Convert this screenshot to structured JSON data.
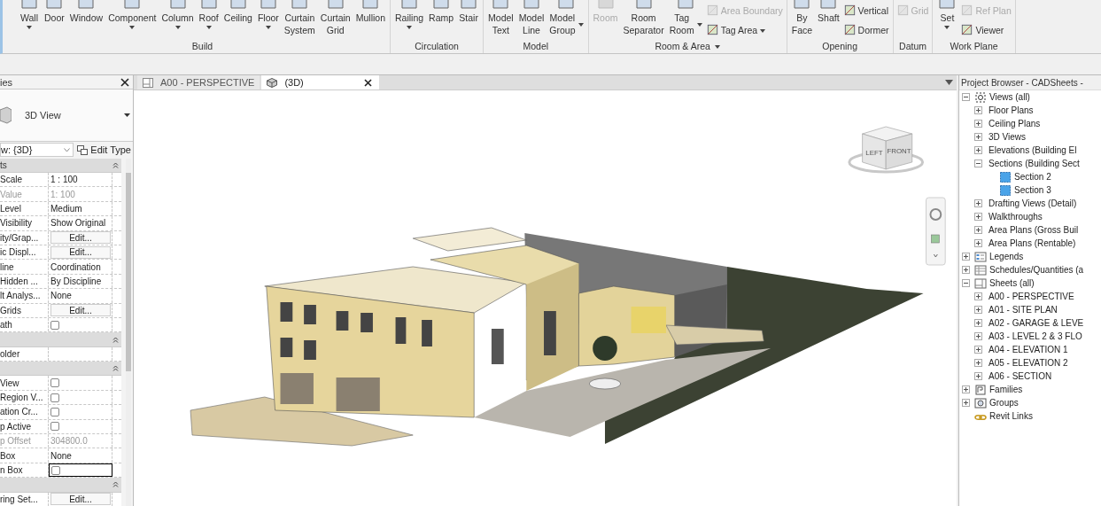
{
  "ribbon": {
    "groups": [
      {
        "label": "Build",
        "menu": false,
        "items": [
          {
            "kind": "large",
            "lines": [
              "Wall"
            ],
            "caret": true,
            "disabled": false
          },
          {
            "kind": "large",
            "lines": [
              "Door"
            ],
            "caret": false,
            "disabled": false
          },
          {
            "kind": "large",
            "lines": [
              "Window"
            ],
            "caret": false,
            "disabled": false
          },
          {
            "kind": "large",
            "lines": [
              "Component"
            ],
            "caret": true,
            "disabled": false
          },
          {
            "kind": "large",
            "lines": [
              "Column"
            ],
            "caret": true,
            "disabled": false
          },
          {
            "kind": "large",
            "lines": [
              "Roof"
            ],
            "caret": true,
            "disabled": false
          },
          {
            "kind": "large",
            "lines": [
              "Ceiling"
            ],
            "caret": false,
            "disabled": false
          },
          {
            "kind": "large",
            "lines": [
              "Floor"
            ],
            "caret": true,
            "disabled": false
          },
          {
            "kind": "large",
            "lines": [
              "Curtain",
              "System"
            ],
            "caret": false,
            "disabled": false
          },
          {
            "kind": "large",
            "lines": [
              "Curtain",
              "Grid"
            ],
            "caret": false,
            "disabled": false
          },
          {
            "kind": "large",
            "lines": [
              "Mullion"
            ],
            "caret": false,
            "disabled": false
          }
        ]
      },
      {
        "label": "Circulation",
        "menu": false,
        "items": [
          {
            "kind": "large",
            "lines": [
              "Railing"
            ],
            "caret": true,
            "disabled": false
          },
          {
            "kind": "large",
            "lines": [
              "Ramp"
            ],
            "caret": false,
            "disabled": false
          },
          {
            "kind": "large",
            "lines": [
              "Stair"
            ],
            "caret": false,
            "disabled": false
          }
        ]
      },
      {
        "label": "Model",
        "menu": false,
        "items": [
          {
            "kind": "large",
            "lines": [
              "Model",
              "Text"
            ],
            "caret": false,
            "disabled": false
          },
          {
            "kind": "large",
            "lines": [
              "Model",
              "Line"
            ],
            "caret": false,
            "disabled": false
          },
          {
            "kind": "large",
            "lines": [
              "Model",
              "Group"
            ],
            "caret": true,
            "disabled": false
          }
        ]
      },
      {
        "label": "Room & Area",
        "menu": true,
        "items": [
          {
            "kind": "large",
            "lines": [
              "Room"
            ],
            "caret": false,
            "disabled": true
          },
          {
            "kind": "large",
            "lines": [
              "Room",
              "Separator"
            ],
            "caret": false,
            "disabled": false
          },
          {
            "kind": "large",
            "lines": [
              "Tag",
              "Room"
            ],
            "caret": true,
            "disabled": false
          },
          {
            "kind": "stack",
            "items": [
              {
                "label": "Area  Boundary",
                "caret": false,
                "disabled": true
              },
              {
                "label": "Tag  Area",
                "caret": true,
                "disabled": false
              }
            ]
          }
        ]
      },
      {
        "label": "Opening",
        "menu": false,
        "items": [
          {
            "kind": "large",
            "lines": [
              "By",
              "Face"
            ],
            "caret": false,
            "disabled": false
          },
          {
            "kind": "large",
            "lines": [
              "Shaft"
            ],
            "caret": false,
            "disabled": false
          },
          {
            "kind": "stack",
            "items": [
              {
                "label": "Vertical",
                "caret": false,
                "disabled": false
              },
              {
                "label": "Dormer",
                "caret": false,
                "disabled": false
              }
            ]
          }
        ]
      },
      {
        "label": "Datum",
        "menu": false,
        "items": [
          {
            "kind": "stack",
            "items": [
              {
                "label": "Grid",
                "caret": false,
                "disabled": true
              }
            ]
          }
        ]
      },
      {
        "label": "Work Plane",
        "menu": false,
        "items": [
          {
            "kind": "large",
            "lines": [
              "Set"
            ],
            "caret": true,
            "disabled": false
          },
          {
            "kind": "stack",
            "items": [
              {
                "label": "Ref Plan",
                "caret": false,
                "disabled": true
              },
              {
                "label": "Viewer",
                "caret": false,
                "disabled": false
              }
            ]
          }
        ]
      }
    ]
  },
  "properties": {
    "title": "ies",
    "type_name": "3D View",
    "instance_selector": "w: {3D}",
    "edit_type": "Edit Type",
    "rows": [
      {
        "kind": "header",
        "label": "ts"
      },
      {
        "kind": "text",
        "label": "Scale",
        "value": "1 : 100",
        "disabled": false
      },
      {
        "kind": "text",
        "label": "Value",
        "value": "1: 100",
        "disabled": true
      },
      {
        "kind": "text",
        "label": "Level",
        "value": "Medium",
        "disabled": false
      },
      {
        "kind": "text",
        "label": "Visibility",
        "value": "Show Original",
        "disabled": false
      },
      {
        "kind": "button",
        "label": "ity/Grap...",
        "value": "Edit...",
        "disabled": false
      },
      {
        "kind": "button",
        "label": "ic Displ...",
        "value": "Edit...",
        "disabled": false
      },
      {
        "kind": "text",
        "label": "line",
        "value": "Coordination",
        "disabled": false
      },
      {
        "kind": "text",
        "label": "Hidden ...",
        "value": "By Discipline",
        "disabled": false
      },
      {
        "kind": "text",
        "label": "lt Analys...",
        "value": "None",
        "disabled": false
      },
      {
        "kind": "button",
        "label": "Grids",
        "value": "Edit...",
        "disabled": false
      },
      {
        "kind": "checkbox",
        "label": "ath",
        "checked": false,
        "disabled": false
      },
      {
        "kind": "header"
      },
      {
        "kind": "empty",
        "label": "older",
        "disabled": false
      },
      {
        "kind": "header"
      },
      {
        "kind": "checkbox",
        "label": "View",
        "checked": false,
        "disabled": false
      },
      {
        "kind": "checkbox",
        "label": "Region V...",
        "checked": false,
        "disabled": false
      },
      {
        "kind": "checkbox",
        "label": "ation Cr...",
        "checked": false,
        "disabled": false
      },
      {
        "kind": "checkbox",
        "label": "p Active",
        "checked": false,
        "disabled": false
      },
      {
        "kind": "text",
        "label": "p Offset",
        "value": "304800.0",
        "disabled": true
      },
      {
        "kind": "text",
        "label": "Box",
        "value": "None",
        "disabled": false
      },
      {
        "kind": "checkbox",
        "label": "n Box",
        "checked": false,
        "disabled": false,
        "focused": true
      },
      {
        "kind": "header"
      },
      {
        "kind": "button",
        "label": "ring Set...",
        "value": "Edit...",
        "disabled": false
      }
    ]
  },
  "view_tabs": [
    {
      "label": "A00 - PERSPECTIVE",
      "kind": "sheet",
      "selected": false
    },
    {
      "label": "(3D)",
      "kind": "model",
      "selected": true
    }
  ],
  "viewcube": {
    "faces": [
      "LEFT",
      "FRONT"
    ]
  },
  "browser": {
    "title": "Project Browser - CADSheets -",
    "tree": [
      {
        "label": "Views (all)",
        "kind": "views",
        "expanded": true,
        "children": [
          {
            "label": "Floor Plans",
            "expanded": false
          },
          {
            "label": "Ceiling Plans",
            "expanded": false
          },
          {
            "label": "3D Views",
            "expanded": false
          },
          {
            "label": "Elevations (Building El",
            "expanded": false
          },
          {
            "label": "Sections (Building Sect",
            "expanded": true,
            "children": [
              {
                "label": "Section 2",
                "kind": "section"
              },
              {
                "label": "Section 3",
                "kind": "section"
              }
            ]
          },
          {
            "label": "Drafting Views (Detail)",
            "expanded": false
          },
          {
            "label": "Walkthroughs",
            "expanded": false
          },
          {
            "label": "Area Plans (Gross Buil",
            "expanded": false
          },
          {
            "label": "Area Plans (Rentable)",
            "expanded": false
          }
        ]
      },
      {
        "label": "Legends",
        "kind": "legends",
        "expanded": false
      },
      {
        "label": "Schedules/Quantities (a",
        "kind": "schedules",
        "expanded": false
      },
      {
        "label": "Sheets (all)",
        "kind": "sheets",
        "expanded": true,
        "children": [
          {
            "label": "A00 - PERSPECTIVE",
            "expanded": false
          },
          {
            "label": "A01 - SITE PLAN",
            "expanded": false
          },
          {
            "label": "A02 - GARAGE & LEVE",
            "expanded": false
          },
          {
            "label": "A03 - LEVEL 2 & 3 FLO",
            "expanded": false
          },
          {
            "label": "A04 - ELEVATION 1",
            "expanded": false
          },
          {
            "label": "A05 - ELEVATION 2",
            "expanded": false
          },
          {
            "label": "A06 - SECTION",
            "expanded": false
          }
        ]
      },
      {
        "label": "Families",
        "kind": "families",
        "expanded": false
      },
      {
        "label": "Groups",
        "kind": "groups",
        "expanded": false
      },
      {
        "label": "Revit Links",
        "kind": "links"
      }
    ]
  }
}
